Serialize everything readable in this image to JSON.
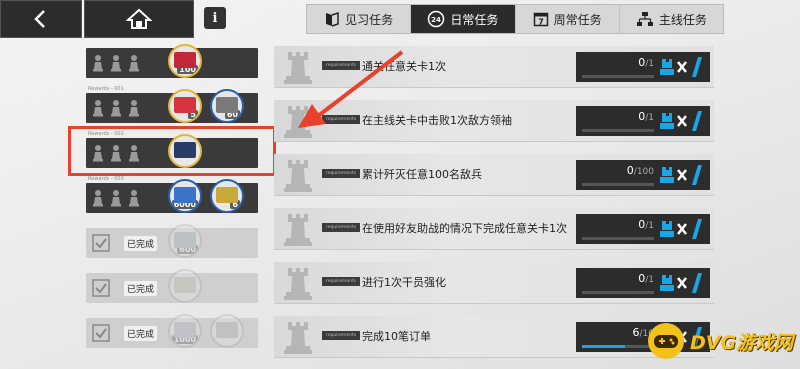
{
  "header": {
    "back_icon": "back-arrow-icon",
    "home_icon": "home-icon",
    "info_label": "i"
  },
  "tabs": [
    {
      "label": "见习任务",
      "icon": "book-flag-icon",
      "active": false
    },
    {
      "label": "日常任务",
      "icon": "24h-icon",
      "active": true
    },
    {
      "label": "周常任务",
      "icon": "calendar-7-icon",
      "active": false
    },
    {
      "label": "主线任务",
      "icon": "hierarchy-icon",
      "active": false
    }
  ],
  "rewards": [
    {
      "status": "pending",
      "caption": "",
      "items": [
        {
          "qty": "100",
          "color": "#c2283a"
        }
      ]
    },
    {
      "status": "pending",
      "caption": "Rewards - 001",
      "items": [
        {
          "qty": "5",
          "color": "#d6343f"
        },
        {
          "qty": "60",
          "color": "#7a7a7a"
        }
      ]
    },
    {
      "status": "pending",
      "caption": "Rewards - 002",
      "items": [
        {
          "qty": "",
          "color": "#2a3c66"
        }
      ]
    },
    {
      "status": "pending",
      "caption": "Rewards - 003",
      "items": [
        {
          "qty": "6000",
          "color": "#3a73c8"
        },
        {
          "qty": "6",
          "color": "#c9a93a"
        }
      ]
    },
    {
      "status": "done",
      "caption": "",
      "done_label": "已完成",
      "items": [
        {
          "qty": "600",
          "color": "#9aa"
        }
      ]
    },
    {
      "status": "done",
      "caption": "",
      "done_label": "已完成",
      "items": [
        {
          "qty": "",
          "color": "#bba"
        }
      ]
    },
    {
      "status": "done",
      "caption": "",
      "done_label": "已完成",
      "items": [
        {
          "qty": "1000",
          "color": "#aab"
        },
        {
          "qty": "",
          "color": "#aaa"
        }
      ]
    }
  ],
  "tasks": [
    {
      "requirement_tag": "requirements",
      "text": "通关任意关卡1次",
      "current": 0,
      "total": 1
    },
    {
      "requirement_tag": "requirements",
      "text": "在主线关卡中击败1次敌方领袖",
      "current": 0,
      "total": 1
    },
    {
      "requirement_tag": "requirements",
      "text": "累计歼灭任意100名敌兵",
      "current": 0,
      "total": 100
    },
    {
      "requirement_tag": "requirements",
      "text": "在使用好友助战的情况下完成任意关卡1次",
      "current": 0,
      "total": 1
    },
    {
      "requirement_tag": "requirements",
      "text": "进行1次干员强化",
      "current": 0,
      "total": 1
    },
    {
      "requirement_tag": "requirements",
      "text": "完成10笔订单",
      "current": 6,
      "total": 10
    }
  ],
  "watermark": {
    "text": "DVG游戏网",
    "color": "#f3c21a"
  },
  "colors": {
    "accent": "#19a6e6",
    "highlight": "#e8412c",
    "dark": "#2c2c2c"
  }
}
